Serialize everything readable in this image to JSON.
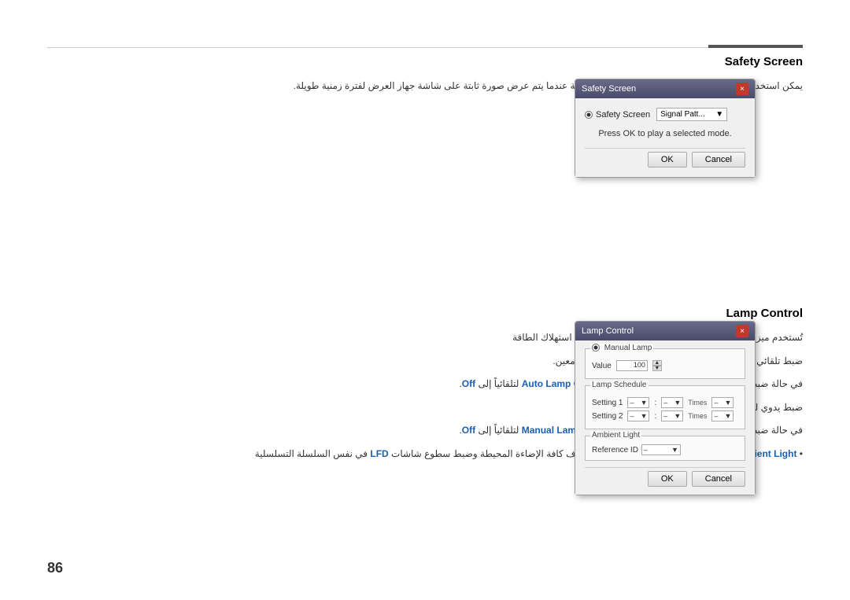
{
  "page": {
    "number": "86",
    "top_line_color": "#ccc",
    "accent_color": "#555"
  },
  "safety_screen": {
    "title": "Safety Screen",
    "arabic_text": "يمكن استخدام وظيفة Safety Screen في منع حرق الشاشة عندما يتم عرض صورة ثابتة على شاشة جهاز العرض لفترة زمنية طويلة.",
    "dialog": {
      "title": "Safety Screen",
      "close_label": "×",
      "radio_label": "Safety Screen",
      "dropdown_label": "Signal Patt...",
      "message": "Press OK to play a selected mode.",
      "ok_label": "OK",
      "cancel_label": "Cancel"
    }
  },
  "lamp_control": {
    "title": "Lamp Control",
    "arabic_lines": [
      "تُستخدم ميزة Lamp Control لضبط الإضاءة الخلفية لتقليل استهلاك الطاقة",
      "ضبط تلقائي للإضاءة الخلفية بجهاز العرض المحدد في وقت معين.",
      "في حالة ضبط Manual Lamp Control ، سيتحول Auto Lamp Control لتلقائياً إلى Off.",
      "ضبط يدوي للإضاءة الخلفية لشاشة العرض المحددة.",
      "في حالة ضبط Auto Lamp Control ، سيتحول Manual Lamp Control لتلقائياً إلى Off.",
      "• Ambient Light : تعمل ميزة Ambient Light على اكتشاف كافة الإضاءة المحيطة وضبط سطوع شاشات LFD في نفس السلسلة التسلسلية"
    ],
    "dialog": {
      "title": "Lamp Control",
      "close_label": "×",
      "manual_label": "Manual Lamp",
      "value_label": "Value",
      "value": "100",
      "lamp_schedule_title": "Lamp Schedule",
      "setting1_label": "Setting 1",
      "setting2_label": "Setting 2",
      "time_label": "Times",
      "ambient_light_title": "Ambient Light",
      "reference_label": "Reference ID",
      "ok_label": "OK",
      "cancel_label": "Cancel"
    }
  }
}
